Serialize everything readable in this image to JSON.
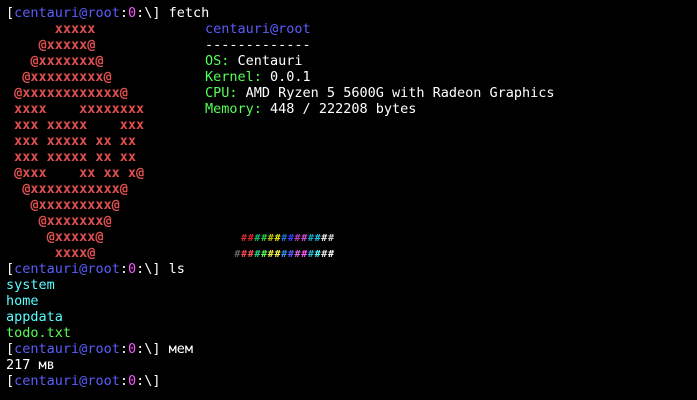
{
  "prompt": {
    "open": "[",
    "user": "centauri",
    "at": "@",
    "host": "root",
    "sep1": ":",
    "tty": "0",
    "sep2": ":",
    "path": "\\",
    "close": "]"
  },
  "session": {
    "cmd1": "fetch",
    "cmd2": "ls",
    "cmd3": "мем",
    "cmd4": ""
  },
  "fetch": {
    "art": [
      "      xxxxx",
      "    @xxxxx@",
      "   @xxxxxxx@",
      "  @xxxxxxxxx@",
      " @xxxxxxxxxxxx@",
      " xxxx    xxxxxxxx",
      " xxx xxxxx    xxx",
      " xxx xxxxx xx xx",
      " xxx xxxxx xx xx",
      " @xxx    xx xx x@",
      "  @xxxxxxxxxxx@",
      "   @xxxxxxxxx@",
      "    @xxxxxxx@",
      "     @xxxxx@",
      "      xxxx@"
    ],
    "title": "centauri@root",
    "rule": "-------------",
    "os_label": "OS:",
    "os_value": "Centauri",
    "kernel_label": "Kernel:",
    "kernel_value": "0.0.1",
    "cpu_label": "CPU:",
    "cpu_value": "AMD Ryzen 5 5600G with Radeon Graphics",
    "memory_label": "Memory:",
    "memory_value": "448 / 222208 bytes",
    "palette_glyph": "#",
    "palette_row1": [
      "#000000",
      "#cd3131",
      "#e02020",
      "#0dbc79",
      "#2ecc40",
      "#c0c000",
      "#e5e510",
      "#2472c8",
      "#3b3bff",
      "#bc3fbc",
      "#d050d0",
      "#11a8cd",
      "#20c0e0",
      "#e5e5e5",
      "#cccccc"
    ],
    "palette_row2": [
      "#666666",
      "#f14c4c",
      "#ff5555",
      "#23d18b",
      "#55ff55",
      "#f5f543",
      "#ffff55",
      "#3b8eea",
      "#5c5cff",
      "#d670d6",
      "#ff55ff",
      "#29b8db",
      "#55ffff",
      "#e5e5e5",
      "#ffffff"
    ]
  },
  "ls": {
    "entries": [
      "system",
      "home",
      "appdata",
      "todo.txt"
    ]
  },
  "mem": {
    "output": "217 мв"
  },
  "colors": {
    "background": "#000000",
    "prompt_user": "#5c5cff",
    "prompt_tty": "#ff55ff",
    "art": "#e05050",
    "info_label": "#55ff55",
    "dir": "#55ffff",
    "file": "#55ff55"
  }
}
